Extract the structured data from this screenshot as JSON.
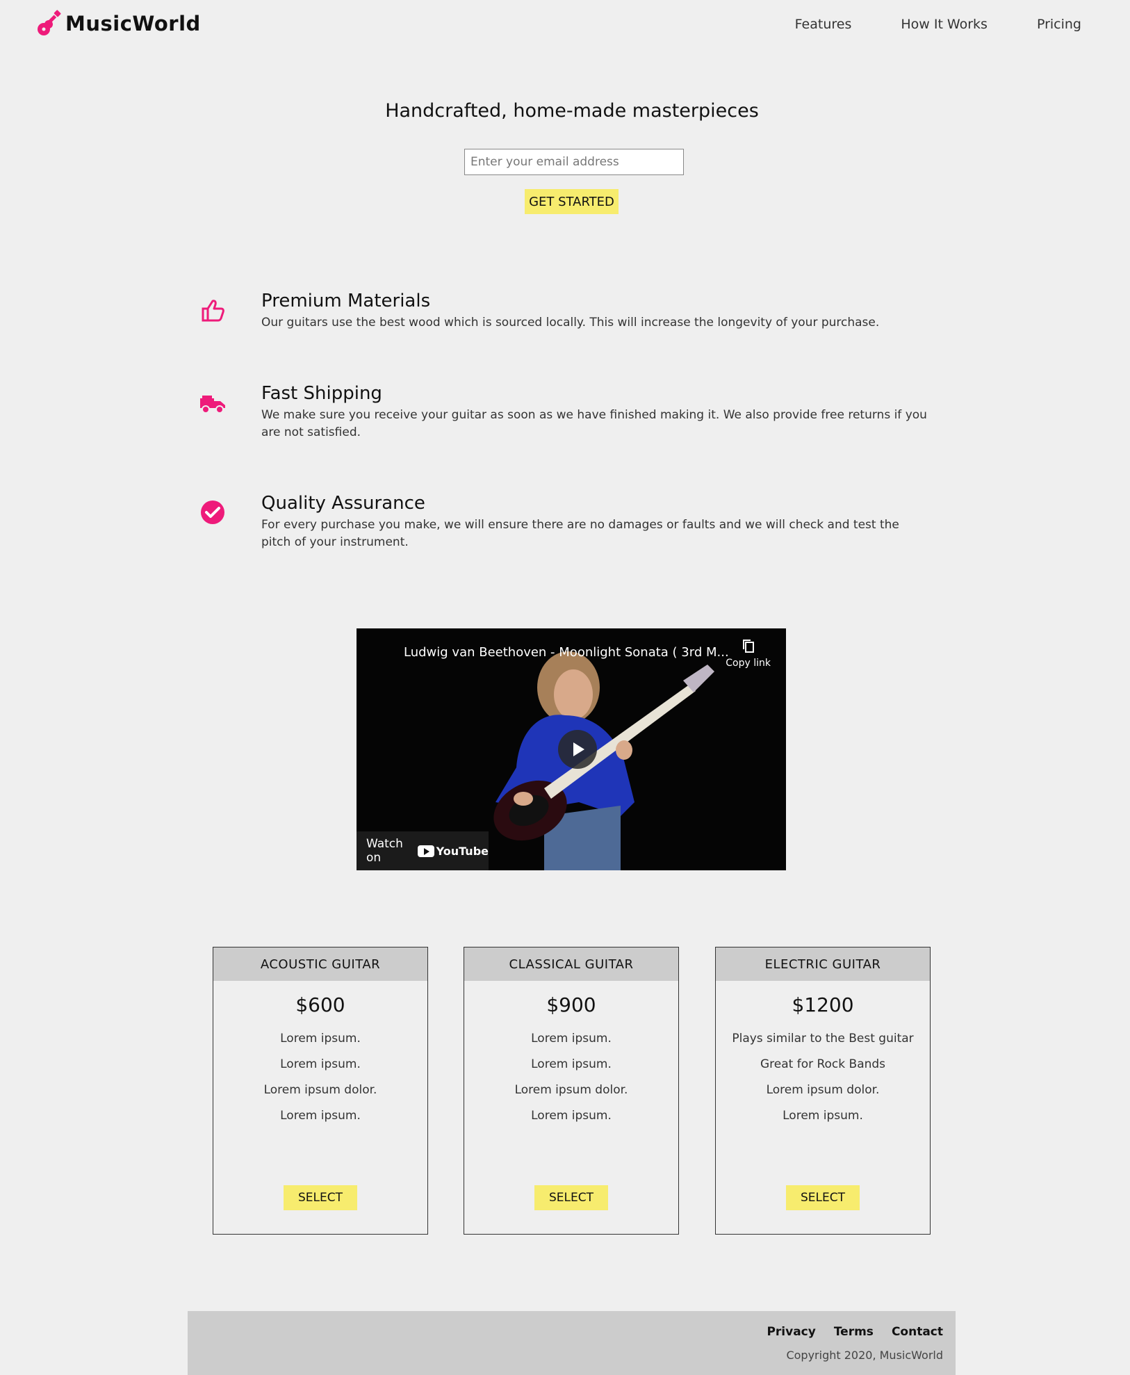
{
  "header": {
    "logo_text": "MusicWorld",
    "nav": [
      "Features",
      "How It Works",
      "Pricing"
    ]
  },
  "hero": {
    "title": "Handcrafted, home-made masterpieces",
    "email_placeholder": "Enter your email address",
    "cta_label": "GET STARTED"
  },
  "features": [
    {
      "icon": "thumbs-up-icon",
      "title": "Premium Materials",
      "text": "Our guitars use the best wood which is sourced locally. This will increase the longevity of your purchase."
    },
    {
      "icon": "truck-icon",
      "title": "Fast Shipping",
      "text": "We make sure you receive your guitar as soon as we have finished making it. We also provide free returns if you are not satisfied."
    },
    {
      "icon": "check-circle-icon",
      "title": "Quality Assurance",
      "text": "For every purchase you make, we will ensure there are no damages or faults and we will check and test the pitch of your instrument."
    }
  ],
  "video": {
    "title": "Ludwig van Beethoven - Moonlight Sonata ( 3rd M...",
    "copy_link": "Copy link",
    "watch_on": "Watch on",
    "youtube": "YouTube"
  },
  "pricing": [
    {
      "name": "ACOUSTIC GUITAR",
      "price": "$600",
      "items": [
        "Lorem ipsum.",
        "Lorem ipsum.",
        "Lorem ipsum dolor.",
        "Lorem ipsum."
      ],
      "button": "SELECT"
    },
    {
      "name": "CLASSICAL GUITAR",
      "price": "$900",
      "items": [
        "Lorem ipsum.",
        "Lorem ipsum.",
        "Lorem ipsum dolor.",
        "Lorem ipsum."
      ],
      "button": "SELECT"
    },
    {
      "name": "ELECTRIC GUITAR",
      "price": "$1200",
      "items": [
        "Plays similar to the Best guitar",
        "Great for Rock Bands",
        "Lorem ipsum dolor.",
        "Lorem ipsum."
      ],
      "button": "SELECT"
    }
  ],
  "footer": {
    "links": [
      "Privacy",
      "Terms",
      "Contact"
    ],
    "copyright": "Copyright 2020, MusicWorld"
  },
  "colors": {
    "accent": "#ee1b7a",
    "button": "#f7ec6e",
    "background": "#efefef",
    "footer": "#cccccc"
  }
}
